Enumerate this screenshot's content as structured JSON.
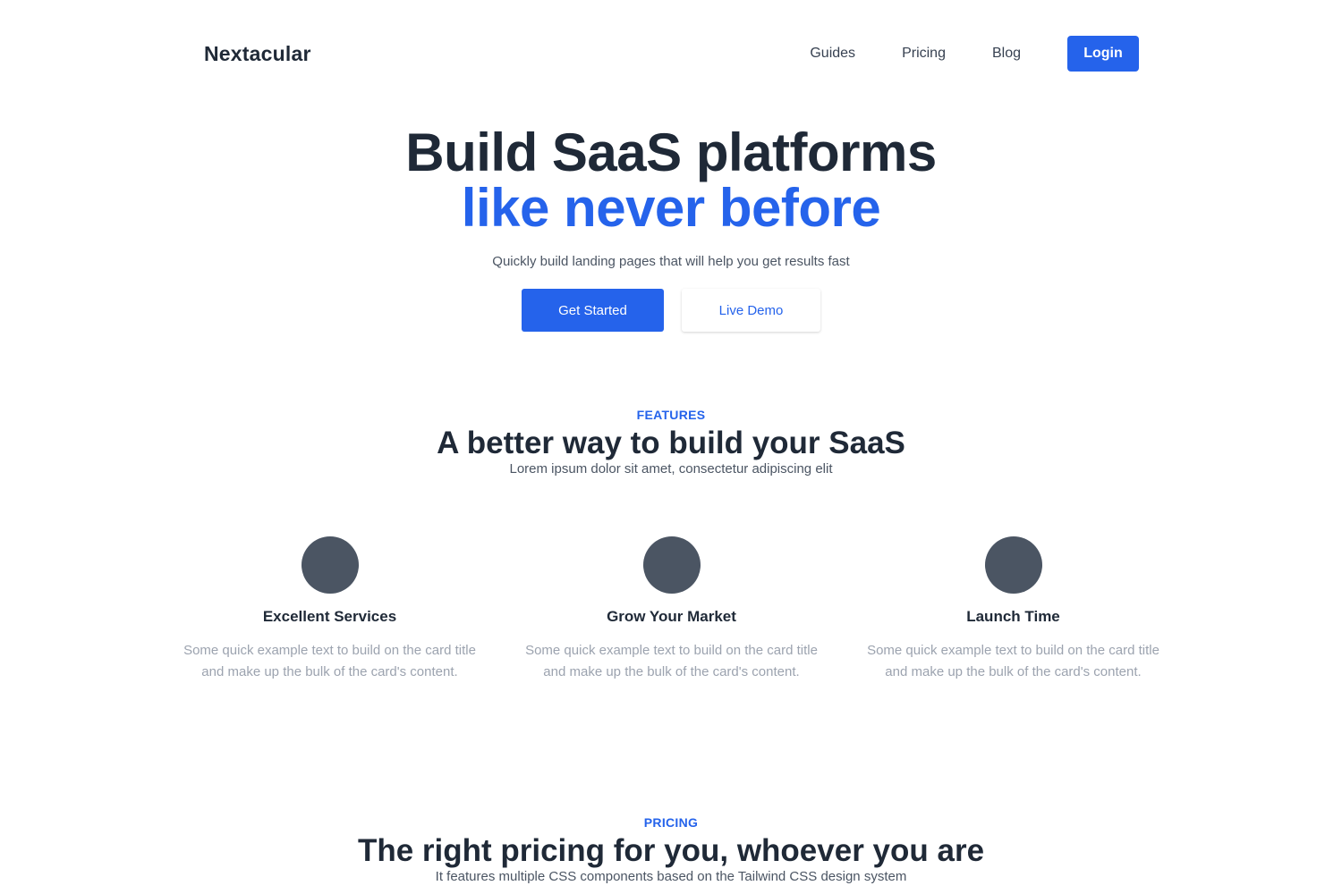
{
  "brand": {
    "name": "Nextacular"
  },
  "nav": {
    "links": [
      "Guides",
      "Pricing",
      "Blog"
    ],
    "login_label": "Login"
  },
  "hero": {
    "title_line1": "Build SaaS platforms",
    "title_line2": "like never before",
    "subtitle": "Quickly build landing pages that will help you get results fast",
    "primary_cta": "Get Started",
    "secondary_cta": "Live Demo"
  },
  "features": {
    "eyebrow": "FEATURES",
    "title": "A better way to build your SaaS",
    "subtitle": "Lorem ipsum dolor sit amet, consectetur adipiscing elit",
    "cards": [
      {
        "title": "Excellent Services",
        "text": "Some quick example text to build on the card title and make up the bulk of the card's content."
      },
      {
        "title": "Grow Your Market",
        "text": "Some quick example text to build on the card title and make up the bulk of the card's content."
      },
      {
        "title": "Launch Time",
        "text": "Some quick example text to build on the card title and make up the bulk of the card's content."
      }
    ]
  },
  "pricing": {
    "eyebrow": "PRICING",
    "title": "The right pricing for you, whoever you are",
    "subtitle": "It features multiple CSS components based on the Tailwind CSS design system"
  },
  "colors": {
    "accent": "#2563eb",
    "text_dark": "#1f2937",
    "icon_placeholder": "#4b5563",
    "muted_text": "#9ca3af"
  }
}
